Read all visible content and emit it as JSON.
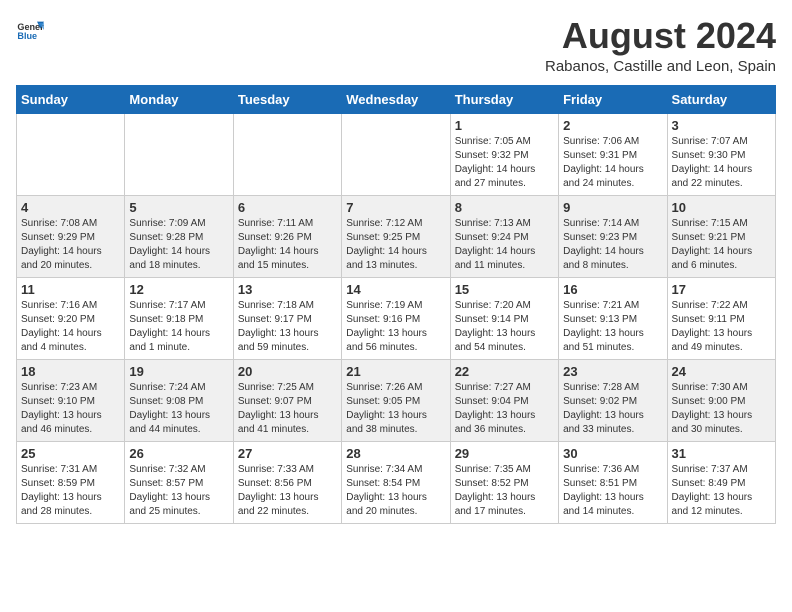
{
  "header": {
    "logo_general": "General",
    "logo_blue": "Blue",
    "main_title": "August 2024",
    "subtitle": "Rabanos, Castille and Leon, Spain"
  },
  "days_of_week": [
    "Sunday",
    "Monday",
    "Tuesday",
    "Wednesday",
    "Thursday",
    "Friday",
    "Saturday"
  ],
  "weeks": [
    [
      {
        "day": "",
        "info": ""
      },
      {
        "day": "",
        "info": ""
      },
      {
        "day": "",
        "info": ""
      },
      {
        "day": "",
        "info": ""
      },
      {
        "day": "1",
        "info": "Sunrise: 7:05 AM\nSunset: 9:32 PM\nDaylight: 14 hours and 27 minutes."
      },
      {
        "day": "2",
        "info": "Sunrise: 7:06 AM\nSunset: 9:31 PM\nDaylight: 14 hours and 24 minutes."
      },
      {
        "day": "3",
        "info": "Sunrise: 7:07 AM\nSunset: 9:30 PM\nDaylight: 14 hours and 22 minutes."
      }
    ],
    [
      {
        "day": "4",
        "info": "Sunrise: 7:08 AM\nSunset: 9:29 PM\nDaylight: 14 hours and 20 minutes."
      },
      {
        "day": "5",
        "info": "Sunrise: 7:09 AM\nSunset: 9:28 PM\nDaylight: 14 hours and 18 minutes."
      },
      {
        "day": "6",
        "info": "Sunrise: 7:11 AM\nSunset: 9:26 PM\nDaylight: 14 hours and 15 minutes."
      },
      {
        "day": "7",
        "info": "Sunrise: 7:12 AM\nSunset: 9:25 PM\nDaylight: 14 hours and 13 minutes."
      },
      {
        "day": "8",
        "info": "Sunrise: 7:13 AM\nSunset: 9:24 PM\nDaylight: 14 hours and 11 minutes."
      },
      {
        "day": "9",
        "info": "Sunrise: 7:14 AM\nSunset: 9:23 PM\nDaylight: 14 hours and 8 minutes."
      },
      {
        "day": "10",
        "info": "Sunrise: 7:15 AM\nSunset: 9:21 PM\nDaylight: 14 hours and 6 minutes."
      }
    ],
    [
      {
        "day": "11",
        "info": "Sunrise: 7:16 AM\nSunset: 9:20 PM\nDaylight: 14 hours and 4 minutes."
      },
      {
        "day": "12",
        "info": "Sunrise: 7:17 AM\nSunset: 9:18 PM\nDaylight: 14 hours and 1 minute."
      },
      {
        "day": "13",
        "info": "Sunrise: 7:18 AM\nSunset: 9:17 PM\nDaylight: 13 hours and 59 minutes."
      },
      {
        "day": "14",
        "info": "Sunrise: 7:19 AM\nSunset: 9:16 PM\nDaylight: 13 hours and 56 minutes."
      },
      {
        "day": "15",
        "info": "Sunrise: 7:20 AM\nSunset: 9:14 PM\nDaylight: 13 hours and 54 minutes."
      },
      {
        "day": "16",
        "info": "Sunrise: 7:21 AM\nSunset: 9:13 PM\nDaylight: 13 hours and 51 minutes."
      },
      {
        "day": "17",
        "info": "Sunrise: 7:22 AM\nSunset: 9:11 PM\nDaylight: 13 hours and 49 minutes."
      }
    ],
    [
      {
        "day": "18",
        "info": "Sunrise: 7:23 AM\nSunset: 9:10 PM\nDaylight: 13 hours and 46 minutes."
      },
      {
        "day": "19",
        "info": "Sunrise: 7:24 AM\nSunset: 9:08 PM\nDaylight: 13 hours and 44 minutes."
      },
      {
        "day": "20",
        "info": "Sunrise: 7:25 AM\nSunset: 9:07 PM\nDaylight: 13 hours and 41 minutes."
      },
      {
        "day": "21",
        "info": "Sunrise: 7:26 AM\nSunset: 9:05 PM\nDaylight: 13 hours and 38 minutes."
      },
      {
        "day": "22",
        "info": "Sunrise: 7:27 AM\nSunset: 9:04 PM\nDaylight: 13 hours and 36 minutes."
      },
      {
        "day": "23",
        "info": "Sunrise: 7:28 AM\nSunset: 9:02 PM\nDaylight: 13 hours and 33 minutes."
      },
      {
        "day": "24",
        "info": "Sunrise: 7:30 AM\nSunset: 9:00 PM\nDaylight: 13 hours and 30 minutes."
      }
    ],
    [
      {
        "day": "25",
        "info": "Sunrise: 7:31 AM\nSunset: 8:59 PM\nDaylight: 13 hours and 28 minutes."
      },
      {
        "day": "26",
        "info": "Sunrise: 7:32 AM\nSunset: 8:57 PM\nDaylight: 13 hours and 25 minutes."
      },
      {
        "day": "27",
        "info": "Sunrise: 7:33 AM\nSunset: 8:56 PM\nDaylight: 13 hours and 22 minutes."
      },
      {
        "day": "28",
        "info": "Sunrise: 7:34 AM\nSunset: 8:54 PM\nDaylight: 13 hours and 20 minutes."
      },
      {
        "day": "29",
        "info": "Sunrise: 7:35 AM\nSunset: 8:52 PM\nDaylight: 13 hours and 17 minutes."
      },
      {
        "day": "30",
        "info": "Sunrise: 7:36 AM\nSunset: 8:51 PM\nDaylight: 13 hours and 14 minutes."
      },
      {
        "day": "31",
        "info": "Sunrise: 7:37 AM\nSunset: 8:49 PM\nDaylight: 13 hours and 12 minutes."
      }
    ]
  ]
}
